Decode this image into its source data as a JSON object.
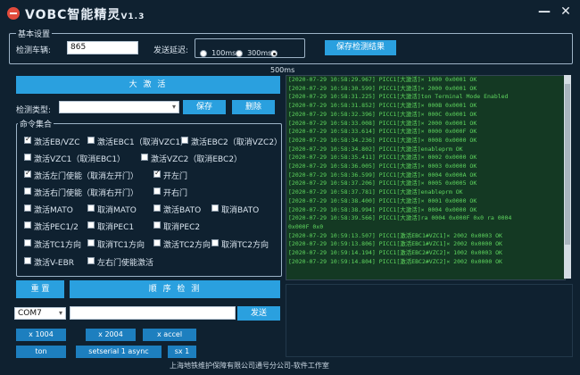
{
  "app": {
    "title": "VOBC智能精灵",
    "version": "V1.3"
  },
  "basic": {
    "legend": "基本设置",
    "vehicle_label": "检测车辆:",
    "vehicle_value": "865",
    "delay_label": "发送延迟:",
    "delay_options": [
      "100ms",
      "300ms",
      "500ms"
    ],
    "delay_selected": "500ms",
    "save_result": "保存检测结果"
  },
  "activate": "大  激  活",
  "detect_type": {
    "label": "检测类型:",
    "value": "",
    "save": "保存",
    "delete": "删除"
  },
  "commands": {
    "legend": "命令集合",
    "items": [
      {
        "label": "激活EB/VZC",
        "checked": true
      },
      {
        "label": "激活EBC1（取消VZC1）",
        "checked": false
      },
      {
        "label": "激活EBC2（取消VZC2）",
        "checked": false
      },
      {
        "label": "激活VZC1（取消EBC1）",
        "checked": false
      },
      {
        "label": "激活VZC2（取消EBC2）",
        "checked": false
      },
      {
        "label": "激活左门使能（取消左开门）",
        "checked": true
      },
      {
        "label": "开左门",
        "checked": true
      },
      {
        "label": "激活右门使能（取消右开门）",
        "checked": false
      },
      {
        "label": "开右门",
        "checked": false
      },
      {
        "label": "激活MATO",
        "checked": false
      },
      {
        "label": "取消MATO",
        "checked": false
      },
      {
        "label": "激活BATO",
        "checked": false
      },
      {
        "label": "取消BATO",
        "checked": false
      },
      {
        "label": "激活PEC1/2",
        "checked": false
      },
      {
        "label": "取消PEC1",
        "checked": false
      },
      {
        "label": "取消PEC2",
        "checked": false
      },
      {
        "label": "激活TC1方向",
        "checked": false
      },
      {
        "label": "取消TC1方向",
        "checked": false
      },
      {
        "label": "激活TC2方向",
        "checked": false
      },
      {
        "label": "取消TC2方向",
        "checked": false
      },
      {
        "label": "激活V-EBR",
        "checked": false
      },
      {
        "label": "左右门使能激活",
        "checked": false
      }
    ]
  },
  "reset": "重  置",
  "sequence": "顺 序 检 测",
  "port": {
    "value": "COM7",
    "send_text": "",
    "send": "发送"
  },
  "quick": [
    "x 1004",
    "x 2004",
    "x accel",
    "ton",
    "setserial 1 async",
    "sx 1"
  ],
  "log_lines": [
    "[2020-07-29 10:58:29.967] PICC1[大激活]× 1000 0x0001        OK",
    "[2020-07-29 10:58:30.599] PICC1[大激活]× 2000 0x0001        OK",
    "[2020-07-29 10:58:31.225] PICC1[大激活]ton      Terminal Mode Enabled",
    "[2020-07-29 10:58:31.852] PICC1[大激活]× 000B 0x0001        OK",
    "[2020-07-29 10:58:32.396] PICC1[大激活]× 000C 0x0001        OK",
    "[2020-07-29 10:58:33.008] PICC1[大激活]× 2000 0x0001        OK",
    "[2020-07-29 10:58:33.614] PICC1[大激活]× 0000 0x000F        OK",
    "[2020-07-29 10:58:34.236] PICC1[大激活]× 0008 0x0000        OK",
    "[2020-07-29 10:58:34.802] PICC1[大激活]enableprm      OK",
    "[2020-07-29 10:58:35.411] PICC1[大激活]× 0002 0x0000        OK",
    "[2020-07-29 10:58:36.005] PICC1[大激活]× 0003 0x0000        OK",
    "[2020-07-29 10:58:36.599] PICC1[大激活]× 0004 0x000A        OK",
    "[2020-07-29 10:58:37.206] PICC1[大激活]× 0005 0x0005        OK",
    "[2020-07-29 10:58:37.781] PICC1[大激活]enableprm      OK",
    "[2020-07-29 10:58:38.400] PICC1[大激活]× 0001 0x0000        OK",
    "[2020-07-29 10:58:38.994] PICC1[大激活]× 0004 0x0000        OK",
    "[2020-07-29 10:58:39.566] PICC1[大激活]ra 0004 0x000F 0x0       ra 0004",
    "0x000F 0x0",
    "[2020-07-29 10:59:13.507] PICC1[激活EBC1#VZC1]× 2002 0x0003        OK",
    "[2020-07-29 10:59:13.806] PICC1[激活EBC1#VZC1]× 2002 0x0000        OK",
    "[2020-07-29 10:59:14.194] PICC1[激活EBC2#VZC2]× 1002 0x0003        OK",
    "[2020-07-29 10:59:14.804] PICC1[激活EBC2#VZC2]× 2002 0x0000        OK"
  ],
  "footer": "上海地铁维护保障有限公司通号分公司-软件工作室"
}
